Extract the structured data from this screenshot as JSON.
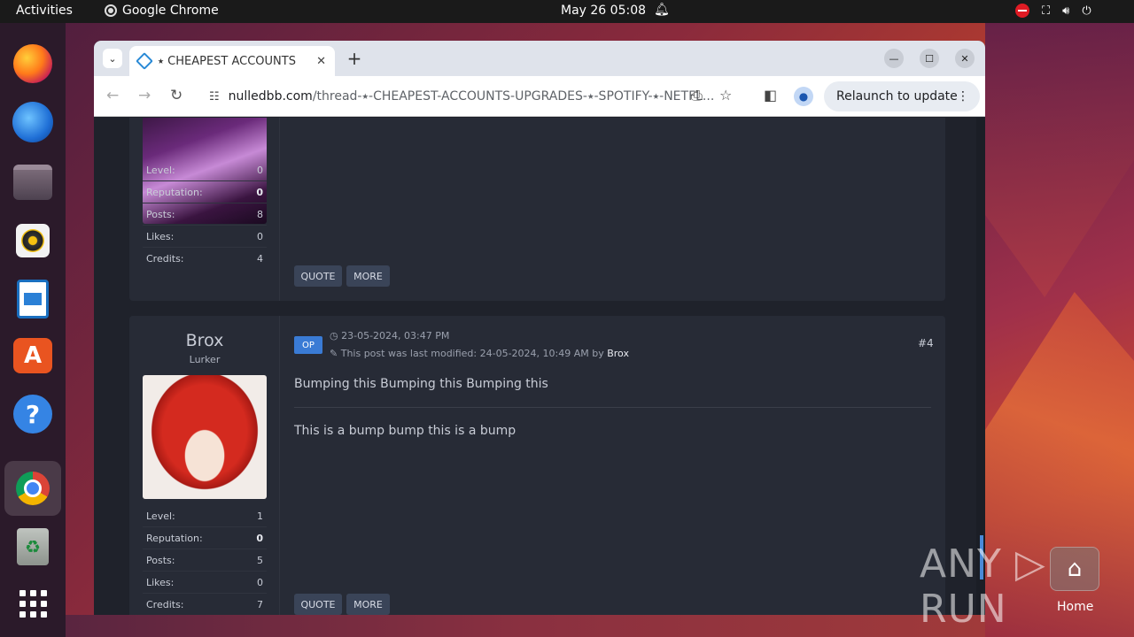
{
  "topbar": {
    "activities": "Activities",
    "app_name": "Google Chrome",
    "clock": "May 26  05:08"
  },
  "browser": {
    "tab_title": "⭑ CHEAPEST ACCOUNTS",
    "url_host": "nulledbb.com",
    "url_path": "/thread-⭑-CHEAPEST-ACCOUNTS-UPGRADES-⭑-SPOTIFY-⭑-NETFL...",
    "relaunch": "Relaunch to update"
  },
  "posts": [
    {
      "stats": [
        {
          "label": "Level:",
          "value": "0"
        },
        {
          "label": "Reputation:",
          "value": "0"
        },
        {
          "label": "Posts:",
          "value": "8"
        },
        {
          "label": "Likes:",
          "value": "0"
        },
        {
          "label": "Credits:",
          "value": "4"
        }
      ],
      "quote": "QUOTE",
      "more": "MORE"
    },
    {
      "username": "Brox",
      "usertitle": "Lurker",
      "op": "OP",
      "date": "23-05-2024, 03:47 PM",
      "modified": "This post was last modified: 24-05-2024, 10:49 AM by ",
      "modified_by": "Brox",
      "number": "#4",
      "line1": "Bumping this Bumping this Bumping this",
      "line2": "This is a bump bump this is a bump",
      "stats": [
        {
          "label": "Level:",
          "value": "1"
        },
        {
          "label": "Reputation:",
          "value": "0"
        },
        {
          "label": "Posts:",
          "value": "5"
        },
        {
          "label": "Likes:",
          "value": "0"
        },
        {
          "label": "Credits:",
          "value": "7"
        }
      ],
      "quote": "QUOTE",
      "more": "MORE"
    }
  ],
  "desktop": {
    "watermark": "ANY ▷ RUN",
    "home_label": "Home"
  }
}
